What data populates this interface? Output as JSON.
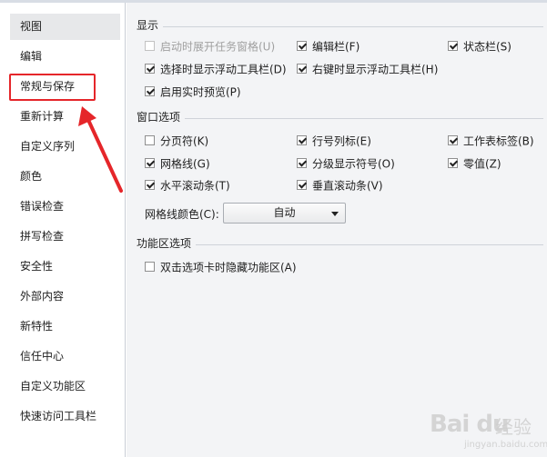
{
  "sidebar": {
    "items": [
      {
        "label": "视图",
        "selected": true
      },
      {
        "label": "编辑"
      },
      {
        "label": "常规与保存"
      },
      {
        "label": "重新计算"
      },
      {
        "label": "自定义序列"
      },
      {
        "label": "颜色"
      },
      {
        "label": "错误检查"
      },
      {
        "label": "拼写检查"
      },
      {
        "label": "安全性"
      },
      {
        "label": "外部内容"
      },
      {
        "label": "新特性"
      },
      {
        "label": "信任中心"
      },
      {
        "label": "自定义功能区"
      },
      {
        "label": "快速访问工具栏"
      }
    ]
  },
  "display": {
    "title": "显示",
    "options": {
      "show_taskpane_on_start": {
        "label": "启动时展开任务窗格(U)",
        "checked": false,
        "disabled": true
      },
      "formula_bar": {
        "label": "编辑栏(F)",
        "checked": true
      },
      "status_bar": {
        "label": "状态栏(S)",
        "checked": true
      },
      "floating_toolbar_select": {
        "label": "选择时显示浮动工具栏(D)",
        "checked": true
      },
      "floating_toolbar_rightclick": {
        "label": "右键时显示浮动工具栏(H)",
        "checked": true
      },
      "live_preview": {
        "label": "启用实时预览(P)",
        "checked": true
      }
    }
  },
  "window": {
    "title": "窗口选项",
    "options": {
      "page_breaks": {
        "label": "分页符(K)",
        "checked": false
      },
      "row_col_headers": {
        "label": "行号列标(E)",
        "checked": true
      },
      "sheet_tabs": {
        "label": "工作表标签(B)",
        "checked": true
      },
      "gridlines": {
        "label": "网格线(G)",
        "checked": true
      },
      "outline_symbols": {
        "label": "分级显示符号(O)",
        "checked": true
      },
      "zero_values": {
        "label": "零值(Z)",
        "checked": true
      },
      "h_scrollbar": {
        "label": "水平滚动条(T)",
        "checked": true
      },
      "v_scrollbar": {
        "label": "垂直滚动条(V)",
        "checked": true
      }
    },
    "gridline_color_label": "网格线颜色(C):",
    "gridline_color_value": "自动"
  },
  "ribbon": {
    "title": "功能区选项",
    "options": {
      "hide_ribbon_on_dblclick": {
        "label": "双击选项卡时隐藏功能区(A)",
        "checked": false
      }
    }
  },
  "annotation": {
    "color": "#e5262a"
  },
  "watermark": {
    "logo": "Bai du",
    "text": "经验",
    "url": "jingyan.baidu.com"
  }
}
